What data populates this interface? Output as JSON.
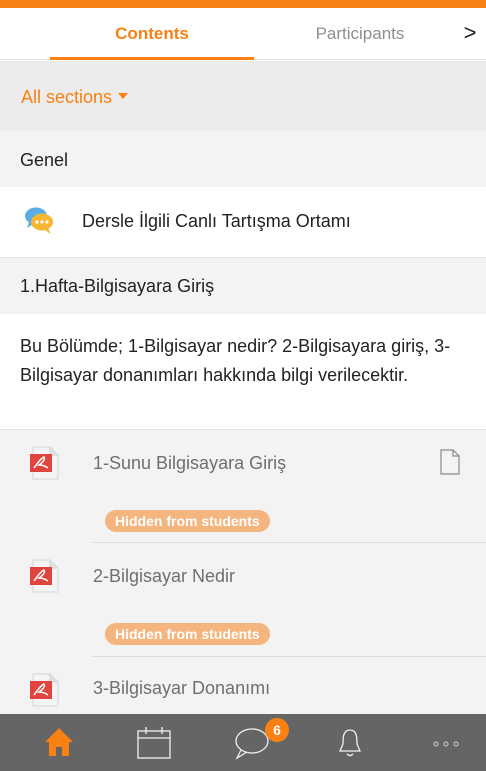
{
  "tabs": {
    "contents": "Contents",
    "participants": "Participants",
    "next": ">"
  },
  "filter": {
    "label": "All sections"
  },
  "sections": [
    {
      "title": "Genel",
      "items": [
        {
          "label": "Dersle İlgili Canlı Tartışma Ortamı",
          "icon": "chat-icon"
        }
      ]
    },
    {
      "title": "1.Hafta-Bilgisayara Giriş",
      "summary": "Bu Bölümde; 1-Bilgisayar nedir? 2-Bilgisayara giriş, 3-Bilgisayar donanımları hakkında bilgi verilecektir.",
      "modules": [
        {
          "label": "1-Sunu Bilgisayara Giriş",
          "icon": "pdf-icon",
          "badge": "Hidden from students"
        },
        {
          "label": "2-Bilgisayar Nedir",
          "icon": "pdf-icon",
          "badge": "Hidden from students"
        },
        {
          "label": "3-Bilgisayar Donanımı",
          "icon": "pdf-icon"
        }
      ]
    }
  ],
  "bottom_nav": {
    "items": [
      "home-icon",
      "calendar-icon",
      "messages-icon",
      "notifications-icon",
      "more-icon"
    ],
    "messages_badge": "6"
  },
  "colors": {
    "accent": "#f98012",
    "badge_bg": "#f5b57e",
    "nav_bg": "#656565"
  }
}
